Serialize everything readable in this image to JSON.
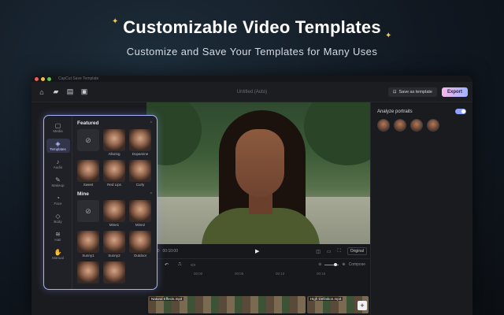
{
  "hero": {
    "title": "Customizable Video Templates",
    "subtitle": "Customize and Save Your Templates for Many Uses"
  },
  "window": {
    "app_name": "CapCut Save Template",
    "project_name": "Untitled (Auto)",
    "toolbar": {
      "icons": [
        "home-icon",
        "folder-icon",
        "document-icon",
        "layout-icon"
      ],
      "save_template_label": "Save as template",
      "export_label": "Export"
    },
    "player": {
      "current_time": "00:00",
      "total_time": "00:10:00",
      "original_label": "Original"
    },
    "right_panel": {
      "analyze_label": "Analyze portraits",
      "analyze_enabled": true,
      "portrait_count": 4
    },
    "timeline": {
      "zoom_label": "Compose",
      "ruler": [
        "00:00",
        "00:05",
        "00:10",
        "00:15"
      ],
      "clips": [
        {
          "label": "Natural Effects.mp4"
        },
        {
          "label": "High Definition.mp4"
        }
      ]
    }
  },
  "popup": {
    "nav": [
      {
        "label": "Media",
        "icon": "media-icon",
        "active": false
      },
      {
        "label": "Templates",
        "icon": "templates-icon",
        "active": true
      },
      {
        "label": "Audio",
        "icon": "audio-icon",
        "active": false
      },
      {
        "label": "Makeup",
        "icon": "makeup-icon",
        "active": false
      },
      {
        "label": "Face",
        "icon": "face-icon",
        "active": false
      },
      {
        "label": "Body",
        "icon": "body-icon",
        "active": false
      },
      {
        "label": "Hair",
        "icon": "hair-icon",
        "active": false
      },
      {
        "label": "Manual",
        "icon": "manual-icon",
        "active": false
      }
    ],
    "featured": {
      "title": "Featured",
      "items": [
        {
          "label": "",
          "none": true
        },
        {
          "label": "Alluring",
          "none": false
        },
        {
          "label": "Dopamine",
          "none": false
        },
        {
          "label": "Sweet",
          "none": false
        },
        {
          "label": "Red Lips",
          "none": false
        },
        {
          "label": "Curly",
          "none": false
        }
      ]
    },
    "mine": {
      "title": "Mine",
      "items": [
        {
          "label": "",
          "none": true
        },
        {
          "label": "Mine1",
          "none": false
        },
        {
          "label": "Mine2",
          "none": false
        },
        {
          "label": "Sunny1",
          "none": false
        },
        {
          "label": "Sunny2",
          "none": false
        },
        {
          "label": "Outdoor",
          "none": false
        },
        {
          "label": "",
          "none": false
        },
        {
          "label": "",
          "none": false
        }
      ]
    }
  },
  "colors": {
    "accent": "#a6b3ff",
    "export_gradient_start": "#f6b6e9",
    "export_gradient_end": "#9fb4ff",
    "sparkle": "#f5c96b"
  }
}
